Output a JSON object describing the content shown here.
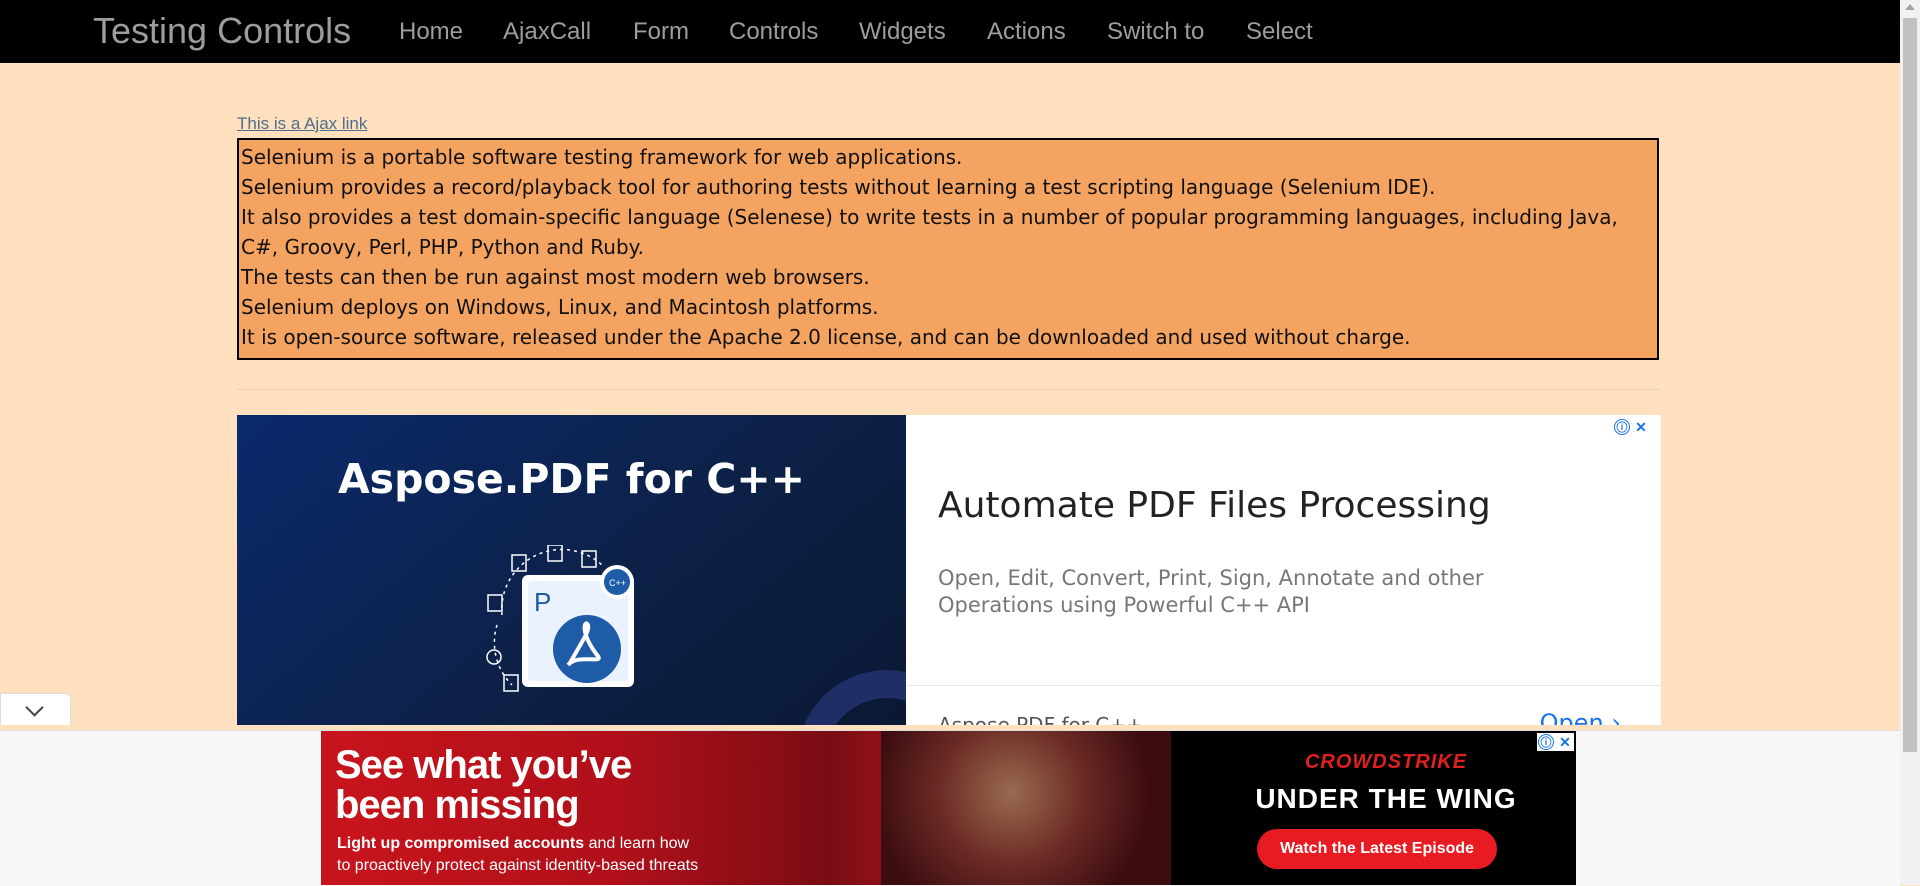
{
  "navbar": {
    "brand": "Testing Controls",
    "items": [
      {
        "label": "Home"
      },
      {
        "label": "AjaxCall"
      },
      {
        "label": "Form"
      },
      {
        "label": "Controls"
      },
      {
        "label": "Widgets"
      },
      {
        "label": "Actions"
      },
      {
        "label": "Switch to"
      },
      {
        "label": "Select"
      }
    ]
  },
  "content": {
    "ajax_link": "This is a Ajax link",
    "lines": [
      "Selenium is a portable software testing framework for web applications.",
      "Selenium provides a record/playback tool for authoring tests without learning a test scripting language (Selenium IDE).",
      "It also provides a test domain-specific language (Selenese) to write tests in a number of popular programming languages, including Java, C#, Groovy, Perl, PHP, Python and Ruby.",
      "The tests can then be run against most modern web browsers.",
      "Selenium deploys on Windows, Linux, and Macintosh platforms.",
      "It is open-source software, released under the Apache 2.0 license, and can be downloaded and used without charge."
    ]
  },
  "ad_banner": {
    "product": "Aspose.PDF for C++",
    "heading": "Automate PDF Files Processing",
    "description": "Open, Edit, Convert, Print, Sign, Annotate and other Operations using Powerful C++ API",
    "footer_text": "Aspose.PDF for C++",
    "open_label": "Open",
    "icon_letter": "P",
    "icon_badge": "C++"
  },
  "sticky_ad": {
    "headline_line1": "See what you’ve",
    "headline_line2": "been missing",
    "sub_bold": "Light up compromised accounts",
    "sub_rest": " and learn how",
    "sub_line2": "to proactively protect against identity-based threats",
    "brand": "CROWDSTRIKE",
    "tagline": "UNDER THE WING",
    "cta": "Watch the Latest Episode"
  },
  "icons": {
    "ad_info": "ⓘ",
    "ad_close": "✕"
  },
  "colors": {
    "navbar_bg": "#000000",
    "page_bg": "#ffe0bf",
    "info_box_bg": "#f4a460",
    "link": "#4e6d8e",
    "ad_accent": "#1a73e8",
    "crowdstrike_red": "#e81b22"
  }
}
